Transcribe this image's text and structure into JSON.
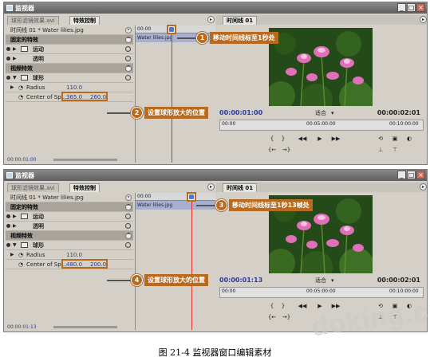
{
  "panels": [
    {
      "window_title": "监视器",
      "tabs": [
        "球形滤镜效果.avi",
        "特效控制"
      ],
      "clip_line": "时间线 01 * Water lilies.jpg",
      "fixed_effects": "固定的特效",
      "motion": "运动",
      "opacity": "透明",
      "video_effects": "视频特效",
      "sphere": "球形",
      "radius_label": "Radius",
      "radius_value": "110.0",
      "center_label": "Center of Sp...",
      "center_x": "365.0",
      "center_y": "260.0",
      "timeline_ruler": "00:00",
      "timeline_clip": "Water lilies.jpg",
      "left_timecode": "00:00:01:00",
      "monitor_tab": "时间线 01",
      "monitor_timecode": "00:00:01:00",
      "fit": "适合",
      "duration": "00:00:02:01",
      "ruler_start": "00:00",
      "ruler_mid": "00:05:00:00",
      "ruler_end": "00:10:00:00",
      "callout_a_num": "1",
      "callout_a_text": "移动时间线标至1秒处",
      "callout_b_num": "2",
      "callout_b_text": "设置球形放大的位置",
      "playhead_fraction": 0.45
    },
    {
      "window_title": "监视器",
      "tabs": [
        "球形滤镜效果.avi",
        "特效控制"
      ],
      "clip_line": "时间线 01 * Water lilies.jpg",
      "fixed_effects": "固定的特效",
      "motion": "运动",
      "opacity": "透明",
      "video_effects": "视频特效",
      "sphere": "球形",
      "radius_label": "Radius",
      "radius_value": "110.0",
      "center_label": "Center of Sp...",
      "center_x": "480.0",
      "center_y": "200.0",
      "timeline_ruler": "00:00",
      "timeline_clip": "Water lilies.jpg",
      "left_timecode": "00:00:01:13",
      "monitor_tab": "时间线 01",
      "monitor_timecode": "00:00:01:13",
      "fit": "适合",
      "duration": "00:00:02:01",
      "ruler_start": "00:00",
      "ruler_mid": "00:05:00:00",
      "ruler_end": "00:10:00:00",
      "callout_a_num": "3",
      "callout_a_text": "移动时间线标至1秒13帧处",
      "callout_b_num": "4",
      "callout_b_text": "设置球形放大的位置",
      "playhead_fraction": 0.7
    }
  ],
  "caption": "图 21-4    监视器窗口编辑素材",
  "watermark": "doking.cn",
  "colors": {
    "accent": "#b86a1e",
    "timecode": "#2a3aa0",
    "playhead": "#e03030"
  }
}
